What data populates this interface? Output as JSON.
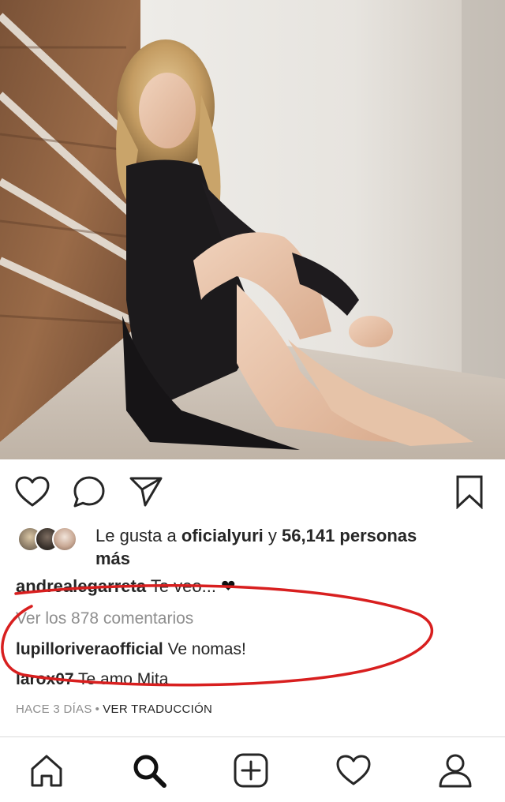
{
  "post": {
    "liked_by_prefix": "Le gusta a ",
    "liked_by_user": "oficialyuri",
    "liked_by_conjunction": " y ",
    "liked_by_count": "56,141 personas",
    "liked_by_suffix": "más",
    "caption_user": "andrealegarreta",
    "caption_text": "Te veo...",
    "caption_emoji": "❤",
    "view_comments": "Ver los 878 comentarios",
    "comments": [
      {
        "user": "lupilloriveraofficial",
        "text": "Ve nomas!"
      },
      {
        "user": "larox07",
        "text": "Te amo Mita"
      }
    ],
    "time_ago": "HACE 3 DÍAS",
    "separator": "•",
    "translate": "VER TRADUCCIÓN"
  },
  "actions": {
    "icons": [
      "heart-icon",
      "comment-icon",
      "share-icon",
      "bookmark-icon"
    ]
  },
  "nav": {
    "icons": [
      "home-icon",
      "search-icon",
      "add-post-icon",
      "activity-heart-icon",
      "profile-icon"
    ]
  },
  "colors": {
    "text": "#262626",
    "muted": "#8e8e8e",
    "annotation_red": "#d81f1f",
    "divider": "#dbdbdb"
  }
}
